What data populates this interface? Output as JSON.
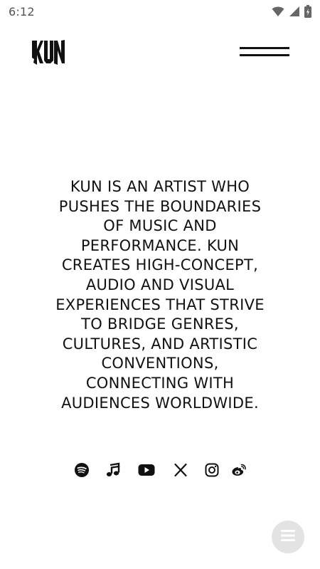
{
  "status_bar": {
    "time": "6:12",
    "icons": [
      "wifi-icon",
      "cellular-signal-icon",
      "battery-icon"
    ]
  },
  "header": {
    "logo_text": "KUN",
    "menu_icon": "hamburger-menu-icon"
  },
  "bio": {
    "lines": [
      "KUN IS AN ARTIST WHO",
      "PUSHES THE BOUNDARIES",
      "OF MUSIC AND",
      "PERFORMANCE. KUN",
      "CREATES HIGH-CONCEPT,",
      "AUDIO AND VISUAL",
      "EXPERIENCES THAT STRIVE",
      "TO BRIDGE GENRES,",
      "CULTURES, AND ARTISTIC",
      "CONVENTIONS,",
      "CONNECTING WITH",
      "AUDIENCES WORLDWIDE."
    ]
  },
  "social": {
    "icons": [
      "spotify-icon",
      "music-note-icon",
      "youtube-icon",
      "x-icon",
      "instagram-icon",
      "weibo-icon"
    ]
  },
  "fab": {
    "icon": "menu-lines-icon"
  },
  "colors": {
    "text": "#111111",
    "background": "#ffffff",
    "fab_background": "#e3e3e3",
    "fab_icon": "#ffffff",
    "status_icons": "#666666"
  }
}
